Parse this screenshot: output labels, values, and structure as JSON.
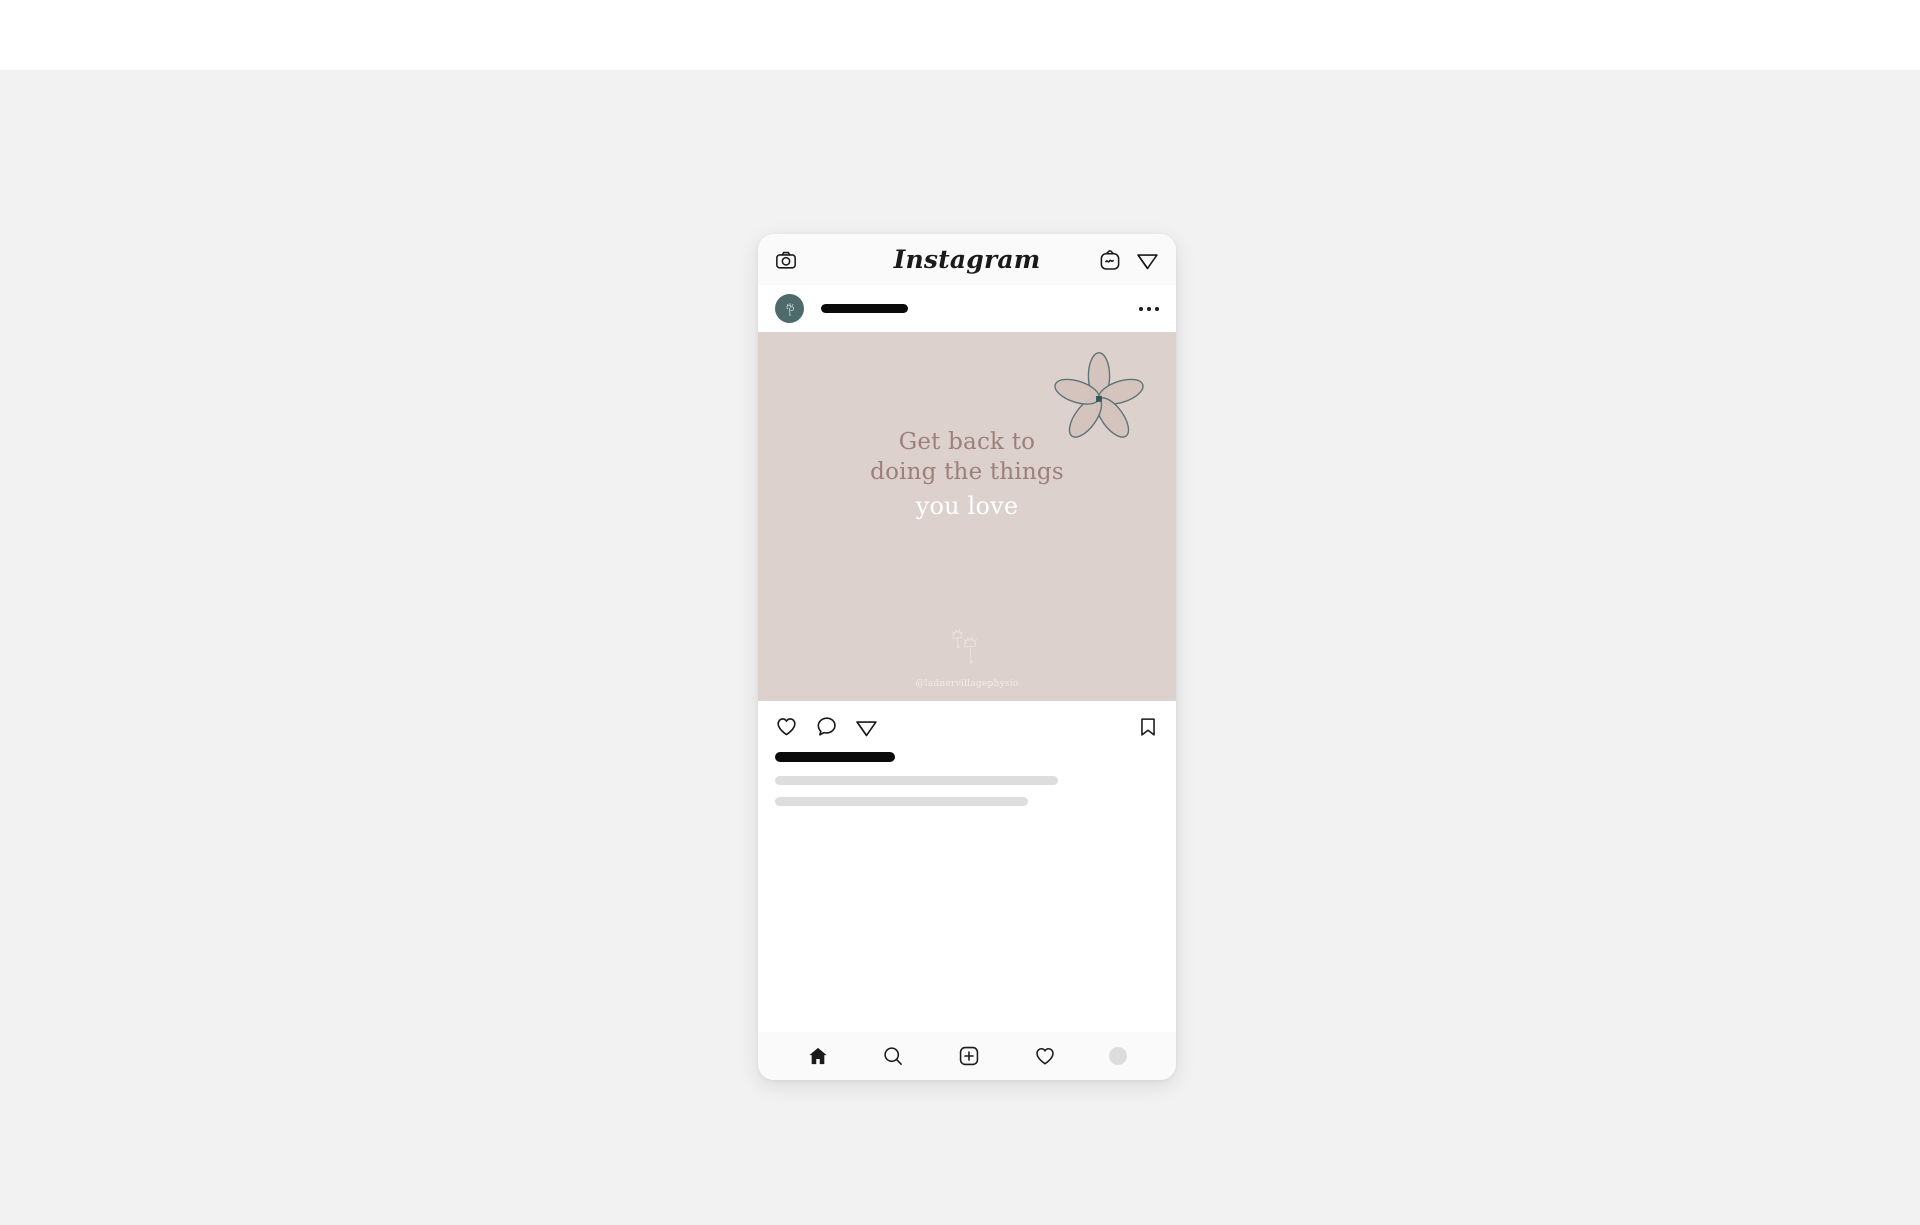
{
  "page": {
    "backdrop_color": "#f2f2f2",
    "top_band_color": "#ffffff"
  },
  "app_bar": {
    "brand": "Instagram",
    "camera_icon": "camera-icon",
    "igtv_icon": "igtv-icon",
    "direct_message_icon": "paper-plane-icon"
  },
  "post_header": {
    "avatar_color": "#4e6a6b",
    "avatar_icon": "dandelion-logo-icon",
    "username_placeholder": "",
    "more_options_icon": "more-options-icon"
  },
  "post_image": {
    "background_color": "#dcd1cd",
    "quote_line_1": "Get back to",
    "quote_line_2": "doing the things",
    "quote_line_3": "you love",
    "quote_color": "#9e7f7a",
    "highlight_color": "#ffffff",
    "flower_icon": "flower-icon",
    "flower_stroke_color": "#4e6a6b",
    "flower_petal_color": "#d4c3bd",
    "dandelion_icon": "dandelion-icon",
    "watermark_handle": "@ladnervillagephysio"
  },
  "actions": {
    "like_icon": "heart-icon",
    "comment_icon": "comment-icon",
    "share_icon": "share-paper-plane-icon",
    "save_icon": "bookmark-icon"
  },
  "caption": {
    "username_placeholder": "",
    "line_1_placeholder": "",
    "line_2_placeholder": ""
  },
  "bottom_nav": {
    "home_icon": "home-icon",
    "search_icon": "search-icon",
    "create_icon": "add-post-icon",
    "activity_icon": "heart-icon",
    "profile_icon": "profile-avatar-icon"
  }
}
